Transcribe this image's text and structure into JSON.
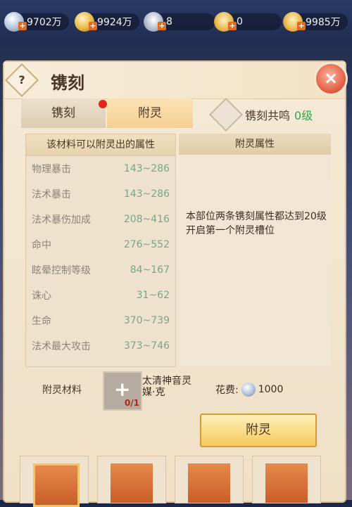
{
  "currencies": [
    {
      "name": "silver-coin",
      "value": "9702万"
    },
    {
      "name": "gold-coin",
      "value": "9924万"
    },
    {
      "name": "silver-ingot",
      "value": "8"
    },
    {
      "name": "gold-ingot",
      "value": "0"
    },
    {
      "name": "gold-ingot-2",
      "value": "9985万"
    }
  ],
  "panel": {
    "help_label": "?",
    "title": "镌刻",
    "close_label": "×"
  },
  "tabs": [
    {
      "label": "镌刻"
    },
    {
      "label": "附灵"
    }
  ],
  "resonance": {
    "label": "镌刻共鸣",
    "level": "0级"
  },
  "left_table": {
    "header": "该材料可以附灵出的属性",
    "rows": [
      {
        "name": "物理暴击",
        "range": "143~286"
      },
      {
        "name": "法术暴击",
        "range": "143~286"
      },
      {
        "name": "法术暴伤加成",
        "range": "208~416"
      },
      {
        "name": "命中",
        "range": "276~552"
      },
      {
        "name": "眩晕控制等级",
        "range": "84~167"
      },
      {
        "name": "诛心",
        "range": "31~62"
      },
      {
        "name": "生命",
        "range": "370~739"
      },
      {
        "name": "法术最大攻击",
        "range": "373~746"
      }
    ]
  },
  "right_panel": {
    "header": "附灵属性",
    "description": "本部位两条镌刻属性都达到20级开启第一个附灵槽位"
  },
  "material": {
    "label": "附灵材料",
    "count": "0/1",
    "name": "太清神音灵媒·克",
    "cost_label": "花费:",
    "cost_value": "1000"
  },
  "action_button": "附灵",
  "bottom_items": [
    {
      "name": "dragon-claw-weapon"
    },
    {
      "name": "purple-blade-weapon"
    },
    {
      "name": "silver-ring"
    },
    {
      "name": "silver-ring-2"
    }
  ]
}
